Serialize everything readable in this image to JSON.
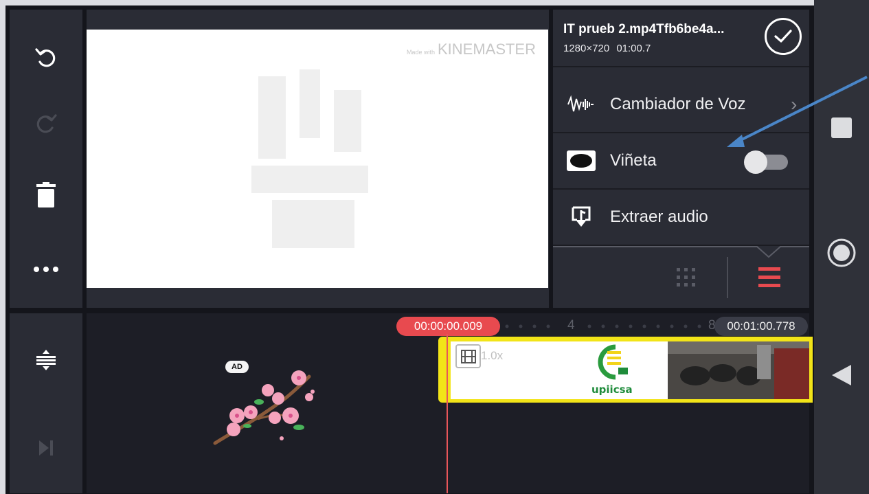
{
  "preview": {
    "watermark_small": "Made with",
    "watermark_brand": "KINEMASTER"
  },
  "clip": {
    "name": "IT prueb 2.mp4Tfb6be4a...",
    "resolution": "1280×720",
    "duration": "01:00.7"
  },
  "menu": {
    "items": [
      {
        "label": "Cambiador de Voz",
        "icon": "voice-waveform-icon"
      },
      {
        "label": "Viñeta",
        "icon": "vignette-icon",
        "toggle": false
      },
      {
        "label": "Extraer audio",
        "icon": "extract-audio-icon"
      }
    ]
  },
  "timeline": {
    "current_time": "00:00:00.009",
    "end_time": "00:01:00.778",
    "ruler_labels": [
      "4",
      "8"
    ],
    "clip_speed": "1.0x",
    "clip_logo_text": "upiicsa",
    "ad_badge": "AD"
  },
  "colors": {
    "accent_red": "#e84a4f",
    "clip_border": "#f2e418",
    "panel_bg": "#2a2c35",
    "arrow": "#4a86c8"
  },
  "toolbar_icons": [
    "undo-icon",
    "redo-icon",
    "delete-icon",
    "more-icon",
    "split-icon",
    "skip-end-icon"
  ],
  "nav_icons": [
    "recents-square-icon",
    "home-circle-icon",
    "back-triangle-icon"
  ]
}
